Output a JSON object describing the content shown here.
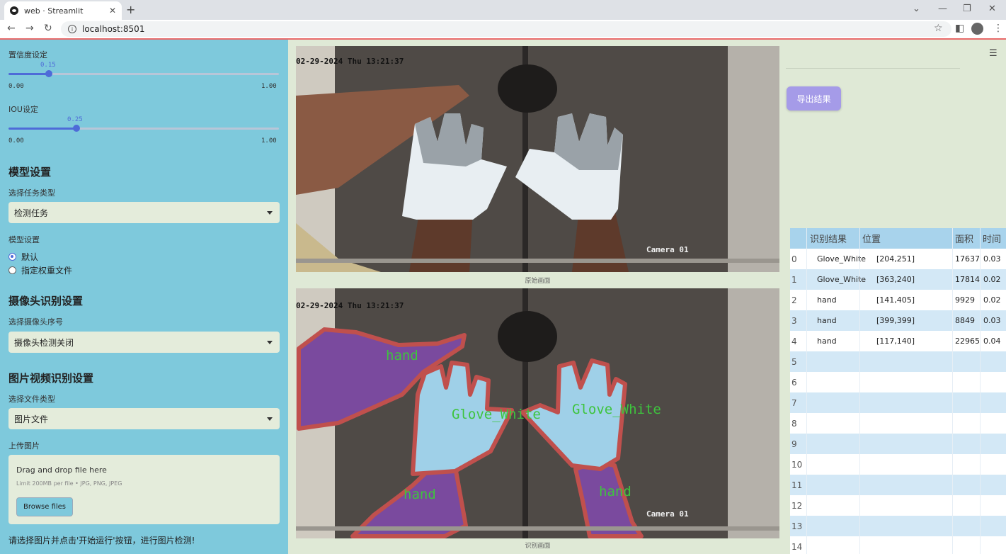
{
  "browser": {
    "tab_title": "web · Streamlit",
    "url": "localhost:8501"
  },
  "sidebar": {
    "confidence": {
      "label": "置信度设定",
      "value": "0.15",
      "value_num": 0.15,
      "min": "0.00",
      "max": "1.00"
    },
    "iou": {
      "label": "IOU设定",
      "value": "0.25",
      "value_num": 0.25,
      "min": "0.00",
      "max": "1.00"
    },
    "model_section": "模型设置",
    "task_label": "选择任务类型",
    "task_value": "检测任务",
    "model_label": "模型设置",
    "model_options": [
      "默认",
      "指定权重文件"
    ],
    "camera_section": "摄像头识别设置",
    "camera_label": "选择摄像头序号",
    "camera_value": "摄像头检测关闭",
    "media_section": "图片视频识别设置",
    "file_type_label": "选择文件类型",
    "file_type_value": "图片文件",
    "upload_label": "上传图片",
    "upload_title": "Drag and drop file here",
    "upload_limit": "Limit 200MB per file • JPG, PNG, JPEG",
    "browse_label": "Browse files",
    "hint": "请选择图片并点击'开始运行'按钮，进行图片检测!"
  },
  "main": {
    "frame_timestamp": "02-29-2024 Thu 13:21:37",
    "camera_label": "Camera 01",
    "original_caption": "原始画面",
    "result_caption": "识别画面",
    "detections": [
      "hand",
      "Glove_White",
      "Glove_White",
      "hand",
      "hand"
    ],
    "export_label": "导出结果"
  },
  "table": {
    "headers": [
      "识别结果",
      "位置",
      "面积",
      "时间"
    ],
    "rows": [
      {
        "idx": "0",
        "label": "Glove_White",
        "pos": "[204,251]",
        "area": "17637",
        "time": "0.03"
      },
      {
        "idx": "1",
        "label": "Glove_White",
        "pos": "[363,240]",
        "area": "17814",
        "time": "0.02"
      },
      {
        "idx": "2",
        "label": "hand",
        "pos": "[141,405]",
        "area": "9929",
        "time": "0.02"
      },
      {
        "idx": "3",
        "label": "hand",
        "pos": "[399,399]",
        "area": "8849",
        "time": "0.03"
      },
      {
        "idx": "4",
        "label": "hand",
        "pos": "[117,140]",
        "area": "22965",
        "time": "0.04"
      }
    ],
    "empty_idx": [
      "5",
      "6",
      "7",
      "8",
      "9",
      "10",
      "11",
      "12",
      "13",
      "14"
    ]
  },
  "colors": {
    "sidebar": "#7ec9dc",
    "accent": "#4e6bd8",
    "export": "#a59be8",
    "mask_hand": "#7a4a9e",
    "mask_glove": "#9fd0e8",
    "outline": "#c0504d",
    "label_text": "#3ec43e"
  }
}
